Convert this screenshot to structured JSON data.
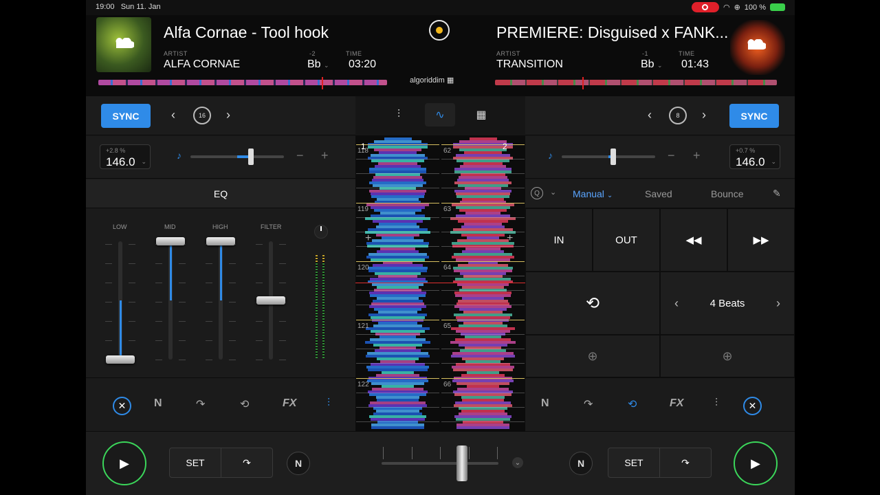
{
  "status": {
    "time": "19:00",
    "date": "Sun 11. Jan",
    "battery": "100 %"
  },
  "deck_a": {
    "title": "Alfa Cornae - Tool hook",
    "artist_label": "ARTIST",
    "artist": "ALFA CORNAE",
    "key_offset": "-2",
    "key": "Bb",
    "time_label": "TIME",
    "time": "03:20",
    "sync": "SYNC",
    "loop_size": "16",
    "pitch_pct": "+2.8 %",
    "bpm": "146.0",
    "pitch_fraction": 0.65
  },
  "deck_b": {
    "title": "PREMIERE: Disguised x FANK...",
    "artist_label": "ARTIST",
    "artist": "TRANSITION",
    "key_offset": "-1",
    "key": "Bb",
    "time_label": "TIME",
    "time": "01:43",
    "sync": "SYNC",
    "loop_size": "8",
    "pitch_pct": "+0.7 %",
    "bpm": "146.0",
    "pitch_fraction": 0.55
  },
  "brand": "algoriddim",
  "eq": {
    "title": "EQ",
    "bands": [
      {
        "label": "LOW",
        "level": 0.0
      },
      {
        "label": "MID",
        "level": 1.0
      },
      {
        "label": "HIGH",
        "level": 1.0
      },
      {
        "label": "FILTER",
        "level": 0.5
      }
    ]
  },
  "waveform": {
    "deck_a_number": "1",
    "deck_b_number": "2",
    "deck_a_beats": [
      "118",
      "119",
      "120",
      "121",
      "122"
    ],
    "deck_b_beats": [
      "62",
      "63",
      "64",
      "65",
      "66"
    ]
  },
  "cue_panel": {
    "tabs": [
      "Manual",
      "Saved",
      "Bounce"
    ],
    "active_tab": "Manual",
    "in": "IN",
    "out": "OUT",
    "loop_length": "4 Beats"
  },
  "transport": {
    "set_label": "SET"
  },
  "colors": {
    "accent": "#2f8be8",
    "play_ring": "#3bd65a",
    "status_red": "#e0202a"
  }
}
